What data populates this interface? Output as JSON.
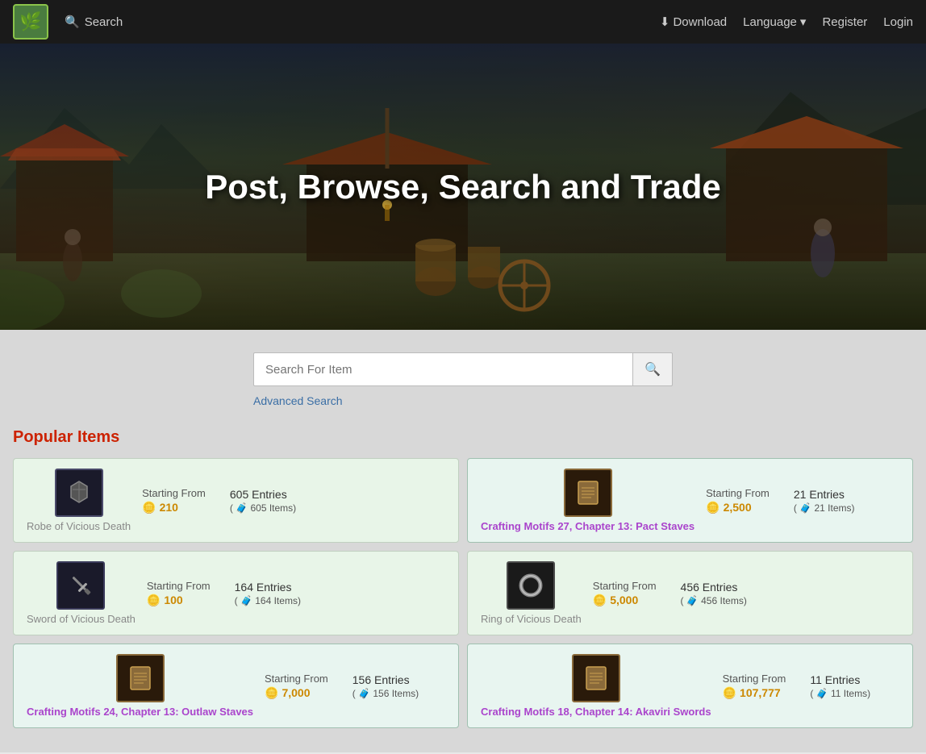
{
  "nav": {
    "logo_icon": "🌿",
    "search_label": "Search",
    "download_label": "Download",
    "language_label": "Language",
    "register_label": "Register",
    "login_label": "Login"
  },
  "hero": {
    "title": "Post, Browse, Search and Trade"
  },
  "search": {
    "placeholder": "Search For Item",
    "advanced_label": "Advanced Search"
  },
  "popular": {
    "title": "Popular Items",
    "items": [
      {
        "id": "robe-vicious-death",
        "name": "Robe of Vicious Death",
        "highlighted": false,
        "icon_type": "armor",
        "starting_from_label": "Starting From",
        "price": "210",
        "entries_count": "605 Entries",
        "items_count": "( 🧳 605 Items)"
      },
      {
        "id": "crafting-motifs-27",
        "name": "Crafting Motifs 27, Chapter 13: Pact Staves",
        "highlighted": true,
        "icon_type": "motif",
        "starting_from_label": "Starting From",
        "price": "2,500",
        "entries_count": "21 Entries",
        "items_count": "( 🧳 21 Items)"
      },
      {
        "id": "sword-vicious-death",
        "name": "Sword of Vicious Death",
        "highlighted": false,
        "icon_type": "sword",
        "starting_from_label": "Starting From",
        "price": "100",
        "entries_count": "164 Entries",
        "items_count": "( 🧳 164 Items)"
      },
      {
        "id": "ring-vicious-death",
        "name": "Ring of Vicious Death",
        "highlighted": false,
        "icon_type": "ring",
        "starting_from_label": "Starting From",
        "price": "5,000",
        "entries_count": "456 Entries",
        "items_count": "( 🧳 456 Items)"
      },
      {
        "id": "crafting-motifs-24",
        "name": "Crafting Motifs 24, Chapter 13: Outlaw Staves",
        "highlighted": true,
        "icon_type": "motif",
        "starting_from_label": "Starting From",
        "price": "7,000",
        "entries_count": "156 Entries",
        "items_count": "( 🧳 156 Items)"
      },
      {
        "id": "crafting-motifs-18",
        "name": "Crafting Motifs 18, Chapter 14: Akaviri Swords",
        "highlighted": true,
        "icon_type": "motif",
        "starting_from_label": "Starting From",
        "price": "107,777",
        "entries_count": "11 Entries",
        "items_count": "( 🧳 11 Items)"
      }
    ]
  }
}
